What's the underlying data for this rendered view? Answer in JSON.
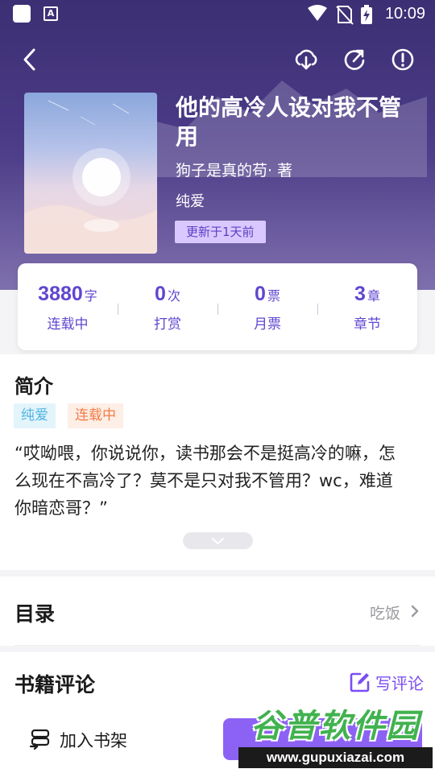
{
  "status_bar": {
    "time": "10:09",
    "icons": [
      "app-square-icon",
      "accessibility-a-icon",
      "wifi-icon",
      "no-sim-icon",
      "battery-charging-icon"
    ]
  },
  "top_bar": {
    "icons": [
      "back-icon",
      "download-icon",
      "share-icon",
      "report-icon"
    ]
  },
  "book": {
    "title": "他的高冷人设对我不管用",
    "author": "狗子是真的苟· 著",
    "genre": "纯爱",
    "update_tag": "更新于1天前"
  },
  "stats": [
    {
      "value": "3880",
      "unit": "字",
      "label": "连载中"
    },
    {
      "value": "0",
      "unit": "次",
      "label": "打赏"
    },
    {
      "value": "0",
      "unit": "票",
      "label": "月票"
    },
    {
      "value": "3",
      "unit": "章",
      "label": "章节"
    }
  ],
  "intro": {
    "title": "简介",
    "tags": [
      "纯爱",
      "连载中"
    ],
    "text": "“哎呦喂，你说说你，读书那会不是挺高冷的嘛，怎么现在不高冷了？莫不是只对我不管用？wc，难道你暗恋哥？”"
  },
  "toc": {
    "title": "目录",
    "latest_chapter": "吃饭"
  },
  "reviews": {
    "title": "书籍评论",
    "write_label": "写评论"
  },
  "bottom_bar": {
    "add_shelf_label": "加入书架"
  },
  "watermark": {
    "name": "谷普软件园",
    "url": "www.gupuxiazai.com"
  },
  "colors": {
    "accent": "#6046d0",
    "button_purple": "#8c62f5",
    "hero_bg": "#3c2f73",
    "tag_blue": "#4fb4e4",
    "tag_orange": "#f27c45"
  }
}
